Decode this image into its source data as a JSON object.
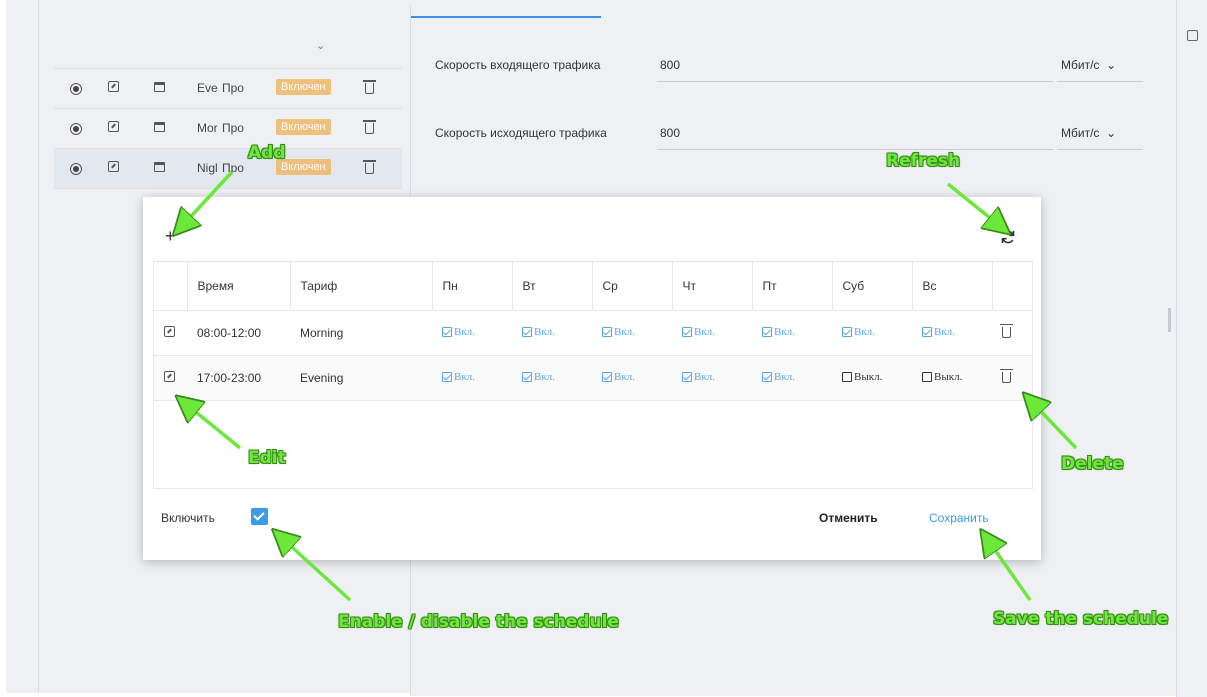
{
  "left_table": {
    "rows": [
      {
        "name": "Eve",
        "tariff": "Про",
        "status": "Включен",
        "selected": false
      },
      {
        "name": "Mor",
        "tariff": "Про",
        "status": "Включен",
        "selected": false
      },
      {
        "name": "Nigl",
        "tariff": "Про",
        "status": "Включен",
        "selected": true
      }
    ]
  },
  "speed": {
    "in_label": "Скорость входящего трафика",
    "in_value": "800",
    "in_unit": "Мбит/с",
    "out_label": "Скорость исходящего трафика",
    "out_value": "800",
    "out_unit": "Мбит/с"
  },
  "modal": {
    "add_symbol": "+",
    "headers": [
      "Время",
      "Тариф",
      "Пн",
      "Вт",
      "Ср",
      "Чт",
      "Пт",
      "Суб",
      "Вс"
    ],
    "rows": [
      {
        "time": "08:00-12:00",
        "tariff": "Morning",
        "days": [
          "Вкл.",
          "Вкл.",
          "Вкл.",
          "Вкл.",
          "Вкл.",
          "Вкл.",
          "Вкл."
        ],
        "days_on": [
          true,
          true,
          true,
          true,
          true,
          true,
          true
        ]
      },
      {
        "time": "17:00-23:00",
        "tariff": "Evening",
        "days": [
          "Вкл.",
          "Вкл.",
          "Вкл.",
          "Вкл.",
          "Вкл.",
          "Выкл.",
          "Выкл."
        ],
        "days_on": [
          true,
          true,
          true,
          true,
          true,
          false,
          false
        ]
      }
    ],
    "enable_label": "Включить",
    "enable_checked": true,
    "cancel_label": "Отменить",
    "save_label": "Сохранить"
  },
  "annotations": {
    "add": "Add",
    "refresh": "Refresh",
    "edit": "Edit",
    "delete": "Delete",
    "enable": "Enable / disable the schedule",
    "save": "Save the schedule"
  },
  "colors": {
    "annotation": "#6ce83a",
    "primary": "#3a9be8",
    "badge": "#f0b768"
  }
}
